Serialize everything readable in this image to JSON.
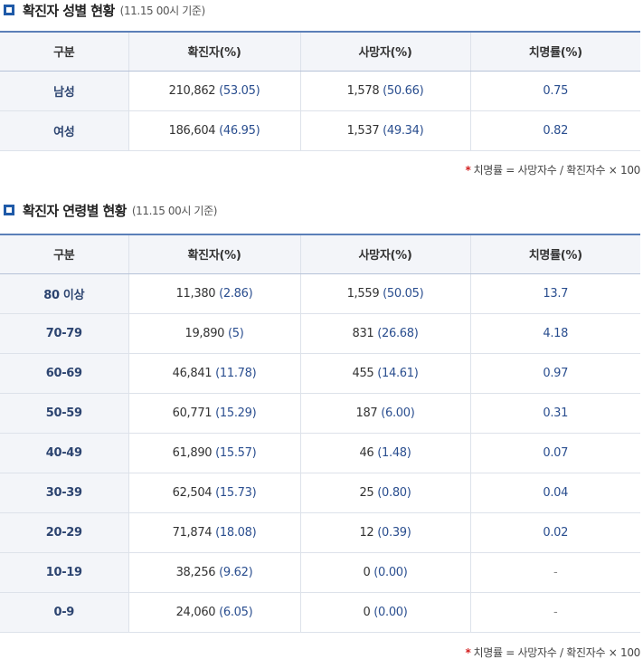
{
  "gender_section": {
    "title": "확진자 성별 현황",
    "note": "(11.15 00시 기준)",
    "headers": [
      "구분",
      "확진자(%)",
      "사망자(%)",
      "치명률(%)"
    ],
    "rows": [
      {
        "label": "남성",
        "cases": "210,862",
        "cases_pct": "(53.05)",
        "deaths": "1,578",
        "deaths_pct": "(50.66)",
        "rate": "0.75"
      },
      {
        "label": "여성",
        "cases": "186,604",
        "cases_pct": "(46.95)",
        "deaths": "1,537",
        "deaths_pct": "(49.34)",
        "rate": "0.82"
      }
    ],
    "footnote_star": "*",
    "footnote": "치명률 = 사망자수 / 확진자수 × 100"
  },
  "age_section": {
    "title": "확진자 연령별 현황",
    "note": "(11.15 00시 기준)",
    "headers": [
      "구분",
      "확진자(%)",
      "사망자(%)",
      "치명률(%)"
    ],
    "rows": [
      {
        "label": "80 이상",
        "cases": "11,380",
        "cases_pct": "(2.86)",
        "deaths": "1,559",
        "deaths_pct": "(50.05)",
        "rate": "13.7"
      },
      {
        "label": "70-79",
        "cases": "19,890",
        "cases_pct": "(5)",
        "deaths": "831",
        "deaths_pct": "(26.68)",
        "rate": "4.18"
      },
      {
        "label": "60-69",
        "cases": "46,841",
        "cases_pct": "(11.78)",
        "deaths": "455",
        "deaths_pct": "(14.61)",
        "rate": "0.97"
      },
      {
        "label": "50-59",
        "cases": "60,771",
        "cases_pct": "(15.29)",
        "deaths": "187",
        "deaths_pct": "(6.00)",
        "rate": "0.31"
      },
      {
        "label": "40-49",
        "cases": "61,890",
        "cases_pct": "(15.57)",
        "deaths": "46",
        "deaths_pct": "(1.48)",
        "rate": "0.07"
      },
      {
        "label": "30-39",
        "cases": "62,504",
        "cases_pct": "(15.73)",
        "deaths": "25",
        "deaths_pct": "(0.80)",
        "rate": "0.04"
      },
      {
        "label": "20-29",
        "cases": "71,874",
        "cases_pct": "(18.08)",
        "deaths": "12",
        "deaths_pct": "(0.39)",
        "rate": "0.02"
      },
      {
        "label": "10-19",
        "cases": "38,256",
        "cases_pct": "(9.62)",
        "deaths": "0",
        "deaths_pct": "(0.00)",
        "rate": "-"
      },
      {
        "label": "0-9",
        "cases": "24,060",
        "cases_pct": "(6.05)",
        "deaths": "0",
        "deaths_pct": "(0.00)",
        "rate": "-"
      }
    ],
    "footnote_star": "*",
    "footnote": "치명률 = 사망자수 / 확진자수 × 100"
  },
  "colors": {
    "accent": "#1f5aa8",
    "header_bg": "#f3f5f9",
    "star": "#d32020"
  }
}
